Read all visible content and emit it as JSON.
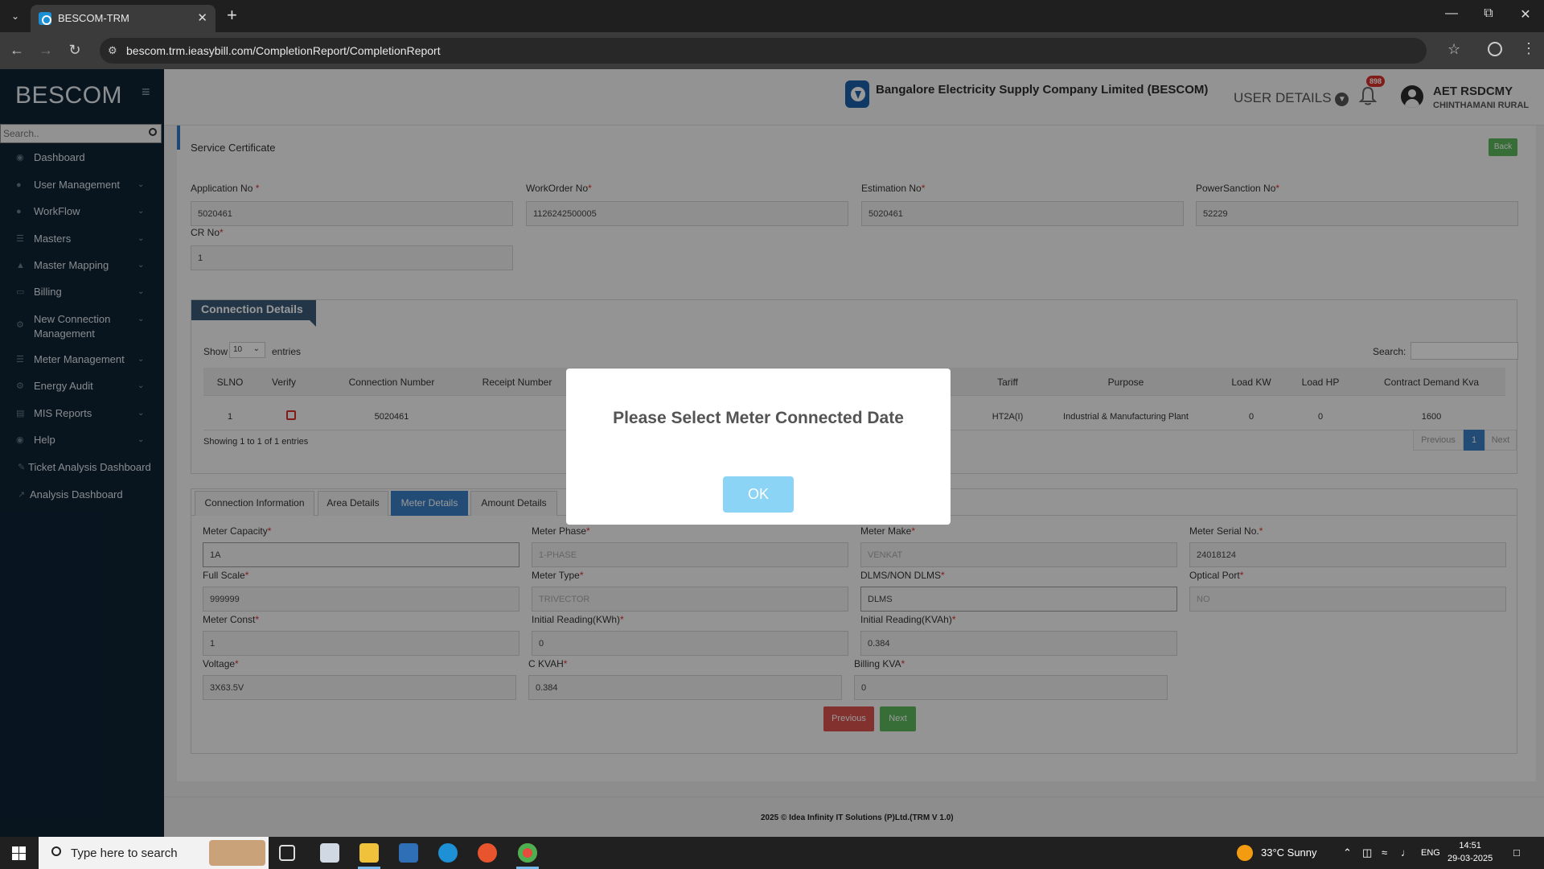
{
  "browser": {
    "tab_title": "BESCOM-TRM",
    "url": "bescom.trm.ieasybill.com/CompletionReport/CompletionReport"
  },
  "sidebar": {
    "brand": "BESCOM",
    "search_placeholder": "Search..",
    "items": [
      {
        "label": "Dashboard",
        "icon": "dashboard-icon",
        "chevron": false
      },
      {
        "label": "User Management",
        "icon": "user-icon",
        "chevron": true
      },
      {
        "label": "WorkFlow",
        "icon": "user-icon",
        "chevron": true
      },
      {
        "label": "Masters",
        "icon": "list-icon",
        "chevron": true
      },
      {
        "label": "Master Mapping",
        "icon": "sitemap-icon",
        "chevron": true
      },
      {
        "label": "Billing",
        "icon": "monitor-icon",
        "chevron": true
      },
      {
        "label": "New Connection",
        "label2": "Management",
        "icon": "gear-icon",
        "chevron": true
      },
      {
        "label": "Meter Management",
        "icon": "list-icon",
        "chevron": true
      },
      {
        "label": "Energy Audit",
        "icon": "gears-icon",
        "chevron": true
      },
      {
        "label": "MIS Reports",
        "icon": "bar-chart-icon",
        "chevron": true
      },
      {
        "label": "Help",
        "icon": "dashboard-icon",
        "chevron": true
      },
      {
        "label": "Ticket Analysis Dashboard",
        "icon": "pencil-icon",
        "chevron": false
      },
      {
        "label": "Analysis Dashboard",
        "icon": "line-chart-icon",
        "chevron": false
      }
    ]
  },
  "header": {
    "company": "Bangalore Electricity Supply Company Limited (BESCOM)",
    "user_details": "USER DETAILS",
    "notifications": "898",
    "user_name": "AET RSDCMY",
    "user_location": "CHINTHAMANI RURAL"
  },
  "page": {
    "title": "Service Certificate",
    "back": "Back"
  },
  "top_form": [
    {
      "label": "Application No",
      "value": "5020461"
    },
    {
      "label": "WorkOrder No",
      "value": "1126242500005"
    },
    {
      "label": "Estimation No",
      "value": "5020461"
    },
    {
      "label": "PowerSanction No",
      "value": "52229"
    },
    {
      "label": "CR No",
      "value": "1"
    }
  ],
  "connection": {
    "heading": "Connection Details",
    "show_label": "Show",
    "page_size": "10",
    "entries_label": "entries",
    "search_label": "Search:",
    "columns": [
      "SLNO",
      "Verify",
      "Connection Number",
      "Receipt Number",
      "Tariff",
      "Purpose",
      "Load KW",
      "Load HP",
      "Contract Demand Kva"
    ],
    "row": {
      "slno": "1",
      "connection_number": "5020461",
      "tariff": "HT2A(I)",
      "purpose": "Industrial & Manufacturing Plant",
      "load_kw": "0",
      "load_hp": "0",
      "contract_demand": "1600"
    },
    "showing": "Showing 1 to 1 of 1 entries",
    "pager": {
      "previous": "Previous",
      "page": "1",
      "next": "Next"
    }
  },
  "tabs": [
    "Connection Information",
    "Area Details",
    "Meter Details",
    "Amount Details"
  ],
  "meter": {
    "fields": [
      {
        "label": "Meter Capacity",
        "value": "1A"
      },
      {
        "label": "Meter Phase",
        "value": "1-PHASE"
      },
      {
        "label": "Meter Make",
        "value": "VENKAT"
      },
      {
        "label": "Meter Serial No.",
        "value": "24018124"
      },
      {
        "label": "Full Scale",
        "value": "999999"
      },
      {
        "label": "Meter Type",
        "value": "TRIVECTOR"
      },
      {
        "label": "DLMS/NON DLMS",
        "value": "DLMS"
      },
      {
        "label": "Optical Port",
        "value": "NO"
      },
      {
        "label": "Meter Const",
        "value": "1"
      },
      {
        "label": "Initial Reading(KWh)",
        "value": "0"
      },
      {
        "label": "Initial Reading(KVAh)",
        "value": "0.384"
      },
      {
        "label": "Voltage",
        "value": "3X63.5V"
      },
      {
        "label": "C KVAH",
        "value": "0.384"
      },
      {
        "label": "Billing KVA",
        "value": "0"
      }
    ],
    "previous": "Previous",
    "next": "Next"
  },
  "footer": "2025 © Idea Infinity IT Solutions (P)Ltd.(TRM V 1.0)",
  "modal": {
    "message": "Please Select Meter Connected Date",
    "ok": "OK"
  },
  "taskbar": {
    "search_placeholder": "Type here to search",
    "weather": "33°C  Sunny",
    "language": "ENG",
    "time": "14:51",
    "date": "29-03-2025"
  }
}
